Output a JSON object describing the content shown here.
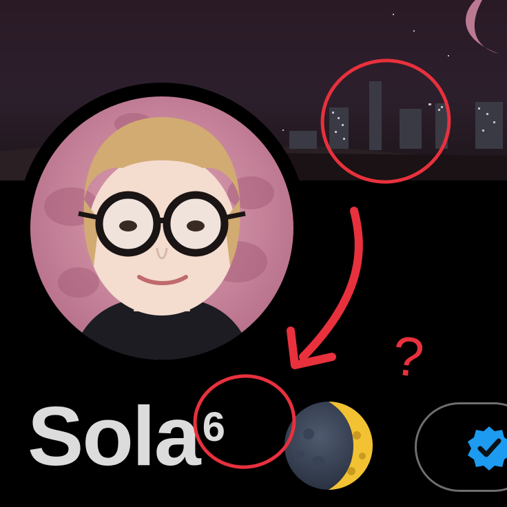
{
  "profile": {
    "display_name": "Sola",
    "name_superscript": "6"
  },
  "icons": {
    "banner": "cityscape-night-banner",
    "avatar": "profile-photo-pink-moon",
    "emoji": "waning-crescent-moon-emoji",
    "verified": "blue-verified-checkmark-icon"
  },
  "annotations": {
    "question_mark": "?"
  },
  "colors": {
    "annotation_red": "#e8313d",
    "verified_blue": "#1d9bf0",
    "name_text": "#dcdcdc",
    "background": "#000000"
  }
}
